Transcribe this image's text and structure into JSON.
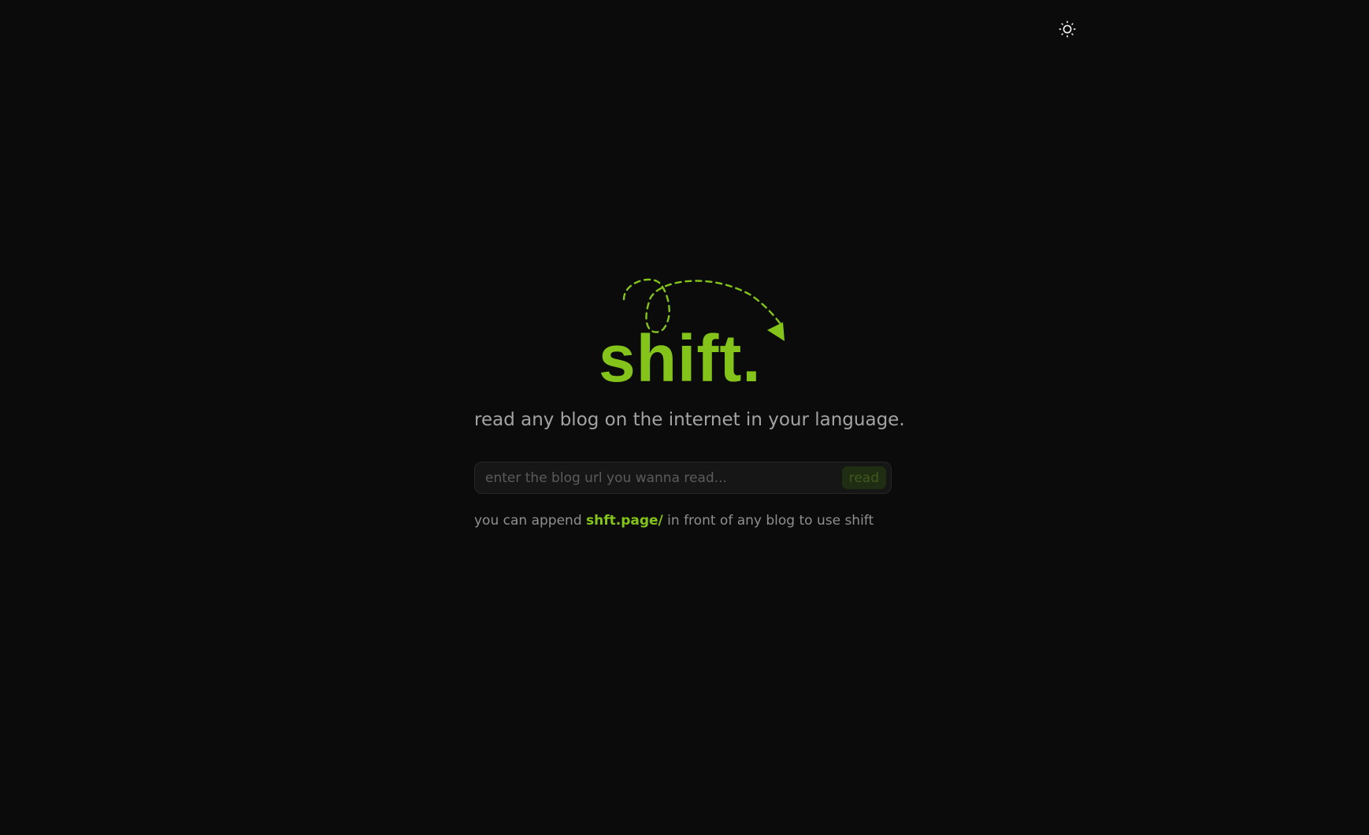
{
  "colors": {
    "background": "#0b0b0b",
    "accent": "#84c41a",
    "text_muted": "#a3a3a3"
  },
  "header": {
    "theme_toggle_icon": "sun-icon"
  },
  "hero": {
    "logo_text": "shift.",
    "logo_decoration_icon": "dashed-curly-arrow-icon",
    "tagline": "read any blog on the internet in your language."
  },
  "search": {
    "placeholder": "enter the blog url you wanna read...",
    "value": "",
    "button_label": "read"
  },
  "hint": {
    "prefix": "you can append",
    "link_text": "shft.page/",
    "suffix": "in front of any blog to use shift"
  }
}
